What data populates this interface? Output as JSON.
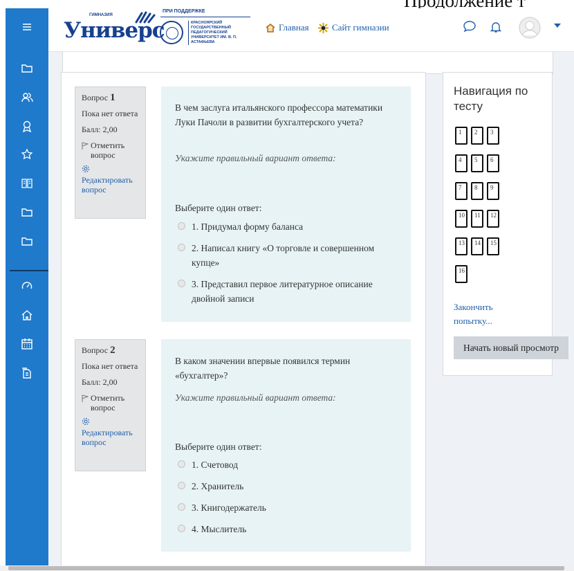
{
  "document": {
    "overflow_text": "Продолжение т"
  },
  "sidebar": {
    "menu_icon": "hamburger-icon",
    "items": [
      {
        "icon": "folder-icon"
      },
      {
        "icon": "users-icon"
      },
      {
        "icon": "award-icon"
      },
      {
        "icon": "star-icon"
      },
      {
        "icon": "book-icon"
      },
      {
        "icon": "folder-icon"
      },
      {
        "icon": "folder-icon"
      },
      {
        "icon": "dashboard-icon"
      },
      {
        "icon": "home-icon"
      },
      {
        "icon": "calendar-icon"
      },
      {
        "icon": "files-icon"
      }
    ],
    "color": "#1f7acb"
  },
  "header": {
    "logo": {
      "gymnasium": "ГИМНАЗИЯ",
      "name": "Универс",
      "support": "ПРИ ПОДДЕРЖКЕ",
      "university": "КРАСНОЯРСКИЙ ГОСУДАРСТВЕННЫЙ ПЕДАГОГИЧЕСКИЙ УНИВЕРСИТЕТ ИМ. В. П. АСТАФЬЕВА"
    },
    "nav": [
      {
        "label": "Главная",
        "icon": "home-icon"
      },
      {
        "label": "Сайт гимназии",
        "icon": "sun-icon"
      }
    ],
    "icons": [
      "chat-icon",
      "bell-icon",
      "avatar-icon",
      "caret-down-icon"
    ]
  },
  "questions": [
    {
      "label": "Вопрос",
      "number": "1",
      "status": "Пока нет ответа",
      "score": "Балл: 2,00",
      "flag": "Отметить вопрос",
      "edit": "Редактировать вопрос",
      "text": "В чем заслуга итальянского профессора математики Луки Пачоли в развитии бухгалтерского учета?",
      "prompt": "Укажите правильный вариант ответа:",
      "choose": "Выберите один ответ:",
      "options": [
        "1. Придумал форму баланса",
        "2. Написал книгу «О торговле и совершенном купце»",
        "3. Представил первое литературное описание двойной записи"
      ]
    },
    {
      "label": "Вопрос",
      "number": "2",
      "status": "Пока нет ответа",
      "score": "Балл: 2,00",
      "flag": "Отметить вопрос",
      "edit": "Редактировать вопрос",
      "text": "В каком значении впервые появился термин «бухгалтер»?",
      "prompt": "Укажите правильный вариант ответа:",
      "choose": "Выберите один ответ:",
      "options": [
        "1. Счетовод",
        "2. Хранитель",
        "3. Книгодержатель",
        "4. Мыслитель"
      ]
    }
  ],
  "quiz_nav": {
    "title": "Навигация по тесту",
    "buttons": [
      "1",
      "2",
      "3",
      "4",
      "5",
      "6",
      "7",
      "8",
      "9",
      "10",
      "11",
      "12",
      "13",
      "14",
      "15",
      "16"
    ],
    "finish": "Закончить попытку...",
    "new_preview": "Начать новый просмотр"
  }
}
